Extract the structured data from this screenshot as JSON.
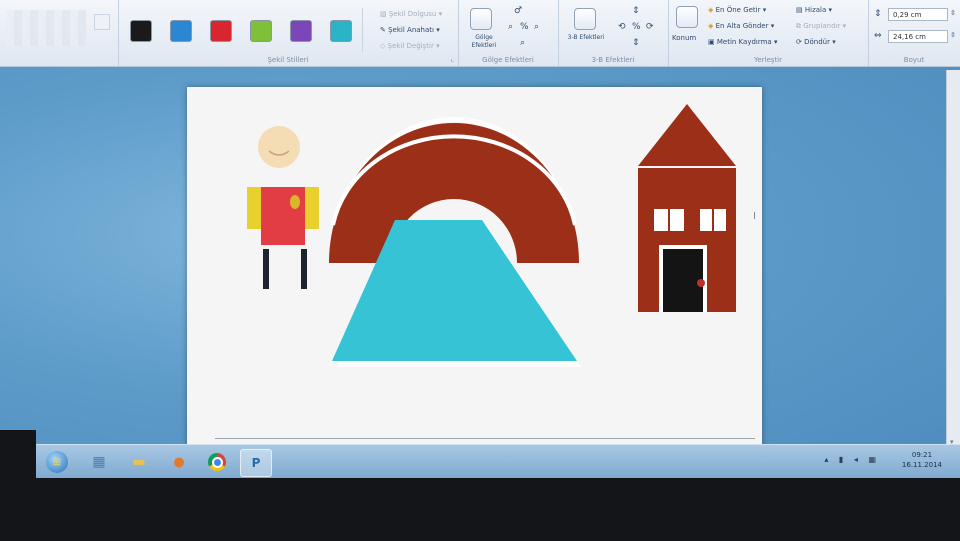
{
  "ribbon": {
    "groups": {
      "shape_styles": {
        "label": "Şekil Stilleri",
        "swatches": [
          "#1a1a1a",
          "#2b87d3",
          "#d7262e",
          "#7fbf3a",
          "#7a46b8",
          "#2bb3c7"
        ],
        "fill_label": "Şekil Dolgusu",
        "outline_label": "Şekil Anahatı",
        "change_label": "Şekil Değiştir"
      },
      "shadow_effects": {
        "label": "Gölge Efektleri",
        "button_label": "Gölge Efektleri"
      },
      "threed_effects": {
        "label": "3-B Efektleri",
        "button_label": "3-B Efektleri"
      },
      "arrange": {
        "label": "Yerleştir",
        "position_label": "Konum",
        "bring_front": "En Öne Getir",
        "send_back": "En Alta Gönder",
        "text_wrap": "Metin Kaydırma",
        "align": "Hizala",
        "group": "Gruplandır",
        "rotate": "Döndür"
      },
      "size": {
        "label": "Boyut",
        "height_value": "0,29 cm",
        "width_value": "24,16 cm"
      }
    }
  },
  "taskbar": {
    "clock_time": "09:21",
    "clock_date": "16.11.2014"
  },
  "colors": {
    "brick": "#9b2f17",
    "turquoise": "#37c3d6",
    "door": "#141414",
    "door_knob": "#c0302a",
    "skin": "#f4dcb4",
    "shirt": "#e23d45",
    "sleeve": "#e8d02f"
  }
}
